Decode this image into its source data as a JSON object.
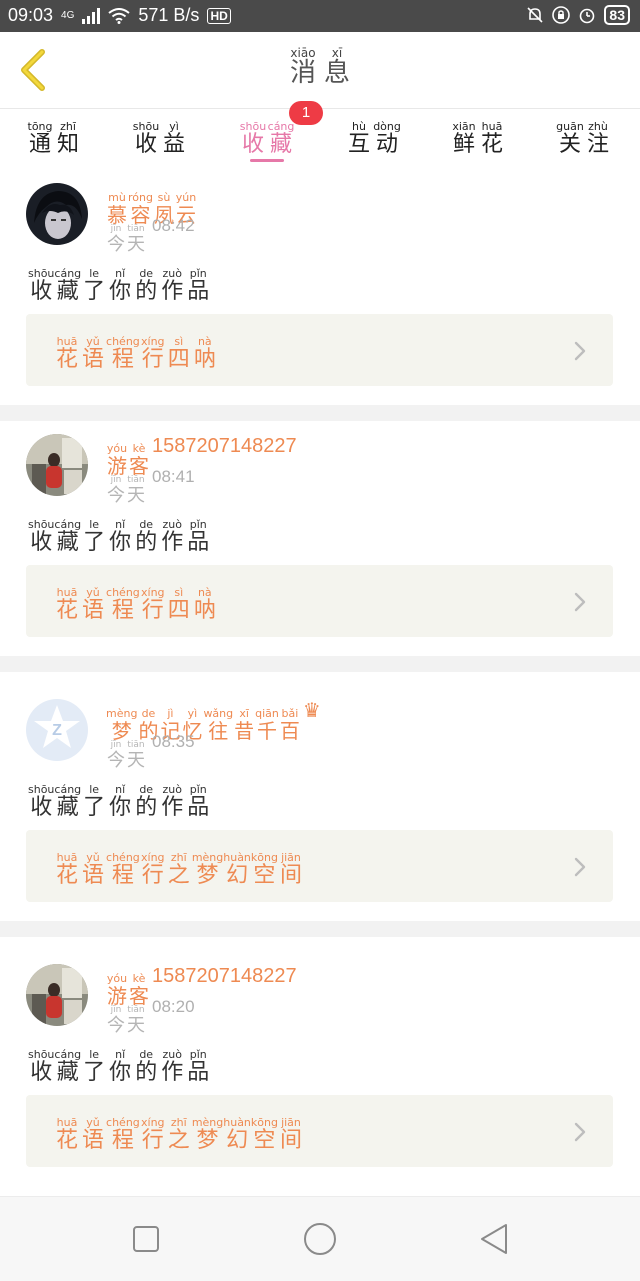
{
  "status": {
    "time": "09:03",
    "net": "4G",
    "speed": "571 B/s",
    "hd": "HD",
    "battery": "83"
  },
  "header": {
    "title": [
      {
        "py": "xiāo",
        "hz": "消"
      },
      {
        "py": "xī",
        "hz": "息"
      }
    ]
  },
  "tabs": [
    {
      "label": [
        {
          "py": "tōng",
          "hz": "通"
        },
        {
          "py": "zhī",
          "hz": "知"
        }
      ]
    },
    {
      "label": [
        {
          "py": "shōu",
          "hz": "收"
        },
        {
          "py": "yì",
          "hz": "益"
        }
      ]
    },
    {
      "label": [
        {
          "py": "shōu",
          "hz": "收"
        },
        {
          "py": "cáng",
          "hz": "藏"
        }
      ],
      "active": true,
      "badge": "1"
    },
    {
      "label": [
        {
          "py": "hù",
          "hz": "互"
        },
        {
          "py": "dòng",
          "hz": "动"
        }
      ]
    },
    {
      "label": [
        {
          "py": "xiān",
          "hz": "鲜"
        },
        {
          "py": "huā",
          "hz": "花"
        }
      ]
    },
    {
      "label": [
        {
          "py": "guān",
          "hz": "关"
        },
        {
          "py": "zhù",
          "hz": "注"
        }
      ]
    }
  ],
  "cards": [
    {
      "avatar": "dark-portrait",
      "name": [
        {
          "py": "mù",
          "hz": "慕"
        },
        {
          "py": "róng",
          "hz": "容"
        },
        {
          "py": "sù",
          "hz": "夙"
        },
        {
          "py": "yún",
          "hz": "云"
        }
      ],
      "name_suffix": "",
      "date": [
        {
          "py": "jīn",
          "hz": "今"
        },
        {
          "py": "tiān",
          "hz": "天"
        }
      ],
      "clock": "08:42",
      "message": [
        {
          "py": "shōu",
          "hz": "收"
        },
        {
          "py": "cáng",
          "hz": "藏"
        },
        {
          "py": "le",
          "hz": "了"
        },
        {
          "py": "nǐ",
          "hz": "你"
        },
        {
          "py": "de",
          "hz": "的"
        },
        {
          "py": "zuò",
          "hz": "作"
        },
        {
          "py": "pǐn",
          "hz": "品"
        }
      ],
      "work": [
        {
          "py": "huā",
          "hz": "花"
        },
        {
          "py": "yǔ",
          "hz": "语"
        },
        {
          "py": "chéng",
          "hz": "程"
        },
        {
          "py": "xíng",
          "hz": "行"
        },
        {
          "py": "sì",
          "hz": "四"
        },
        {
          "py": "nà",
          "hz": "呐"
        }
      ]
    },
    {
      "avatar": "photo",
      "name": [
        {
          "py": "yóu",
          "hz": "游"
        },
        {
          "py": "kè",
          "hz": "客"
        }
      ],
      "name_suffix": "1587207148227",
      "date": [
        {
          "py": "jīn",
          "hz": "今"
        },
        {
          "py": "tiān",
          "hz": "天"
        }
      ],
      "clock": "08:41",
      "message": [
        {
          "py": "shōu",
          "hz": "收"
        },
        {
          "py": "cáng",
          "hz": "藏"
        },
        {
          "py": "le",
          "hz": "了"
        },
        {
          "py": "nǐ",
          "hz": "你"
        },
        {
          "py": "de",
          "hz": "的"
        },
        {
          "py": "zuò",
          "hz": "作"
        },
        {
          "py": "pǐn",
          "hz": "品"
        }
      ],
      "work": [
        {
          "py": "huā",
          "hz": "花"
        },
        {
          "py": "yǔ",
          "hz": "语"
        },
        {
          "py": "chéng",
          "hz": "程"
        },
        {
          "py": "xíng",
          "hz": "行"
        },
        {
          "py": "sì",
          "hz": "四"
        },
        {
          "py": "nà",
          "hz": "呐"
        }
      ]
    },
    {
      "avatar": "default-z",
      "name": [
        {
          "py": "mèng",
          "hz": "梦"
        },
        {
          "py": "de",
          "hz": "的"
        },
        {
          "py": "jì",
          "hz": "记"
        },
        {
          "py": "yì",
          "hz": "忆"
        },
        {
          "py": "wǎng",
          "hz": "往"
        },
        {
          "py": "xī",
          "hz": "昔"
        },
        {
          "py": "qiān",
          "hz": "千"
        },
        {
          "py": "bǎi",
          "hz": "百"
        }
      ],
      "name_suffix": "♛",
      "date": [
        {
          "py": "jīn",
          "hz": "今"
        },
        {
          "py": "tiān",
          "hz": "天"
        }
      ],
      "clock": "08:35",
      "message": [
        {
          "py": "shōu",
          "hz": "收"
        },
        {
          "py": "cáng",
          "hz": "藏"
        },
        {
          "py": "le",
          "hz": "了"
        },
        {
          "py": "nǐ",
          "hz": "你"
        },
        {
          "py": "de",
          "hz": "的"
        },
        {
          "py": "zuò",
          "hz": "作"
        },
        {
          "py": "pǐn",
          "hz": "品"
        }
      ],
      "work": [
        {
          "py": "huā",
          "hz": "花"
        },
        {
          "py": "yǔ",
          "hz": "语"
        },
        {
          "py": "chéng",
          "hz": "程"
        },
        {
          "py": "xíng",
          "hz": "行"
        },
        {
          "py": "zhī",
          "hz": "之"
        },
        {
          "py": "mèng",
          "hz": "梦"
        },
        {
          "py": "huàn",
          "hz": "幻"
        },
        {
          "py": "kōng",
          "hz": "空"
        },
        {
          "py": "jiān",
          "hz": "间"
        }
      ]
    },
    {
      "avatar": "photo",
      "name": [
        {
          "py": "yóu",
          "hz": "游"
        },
        {
          "py": "kè",
          "hz": "客"
        }
      ],
      "name_suffix": "1587207148227",
      "date": [
        {
          "py": "jīn",
          "hz": "今"
        },
        {
          "py": "tiān",
          "hz": "天"
        }
      ],
      "clock": "08:20",
      "message": [
        {
          "py": "shōu",
          "hz": "收"
        },
        {
          "py": "cáng",
          "hz": "藏"
        },
        {
          "py": "le",
          "hz": "了"
        },
        {
          "py": "nǐ",
          "hz": "你"
        },
        {
          "py": "de",
          "hz": "的"
        },
        {
          "py": "zuò",
          "hz": "作"
        },
        {
          "py": "pǐn",
          "hz": "品"
        }
      ],
      "work": [
        {
          "py": "huā",
          "hz": "花"
        },
        {
          "py": "yǔ",
          "hz": "语"
        },
        {
          "py": "chéng",
          "hz": "程"
        },
        {
          "py": "xíng",
          "hz": "行"
        },
        {
          "py": "zhī",
          "hz": "之"
        },
        {
          "py": "mèng",
          "hz": "梦"
        },
        {
          "py": "huàn",
          "hz": "幻"
        },
        {
          "py": "kōng",
          "hz": "空"
        },
        {
          "py": "jiān",
          "hz": "间"
        }
      ]
    }
  ],
  "colors": {
    "accent": "#e678a8",
    "name": "#ee8a52",
    "badge": "#ee3b45",
    "work_bg": "#f4f4ee"
  }
}
